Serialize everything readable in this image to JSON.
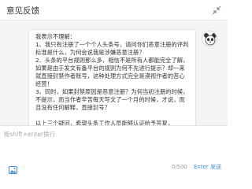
{
  "window": {
    "title": "意见反馈",
    "collapse_icon": "collapse-arrows-icon"
  },
  "chat": {
    "message_text": "我表示不理解：\n1、我只有注册了一个个人头条号，请问你们恶意注册的评判标准是什么，为何会说我是涉嫌恶意注册？\n2、头条的平台规则那么多，相信不是所有人都能完全了解，如果是由于发文有备平台的规则为何不先进行提示？却一来就直接封禁作者账号，这种处理方式完全是漠视作者的苦心经营！\n3、同时，如果封禁原因是恶意注册？为何当初注册的时候，不提示，而当作者辛苦每天写文了一个月的时候，才说，而且没有任何解释，直接封号？\n\n以上三个疑问，希望头条工作人员能够认证给予答复，",
    "avatar_icon": "panda-avatar-icon"
  },
  "composer": {
    "placeholder": "按shift+enter换行",
    "value": "",
    "image_icon": "image-icon",
    "counter": "0/500",
    "send_label": "Enter 发送"
  },
  "colors": {
    "accent": "#3f8ed8",
    "chat_background": "#f4f4f4"
  }
}
